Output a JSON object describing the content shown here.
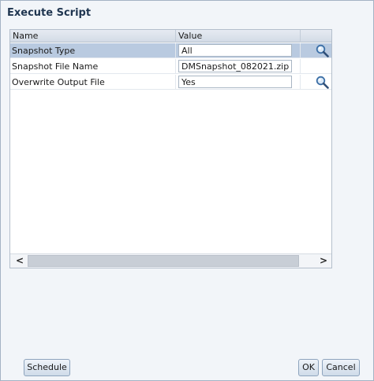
{
  "dialog": {
    "title": "Execute Script"
  },
  "grid": {
    "columns": {
      "name": "Name",
      "value": "Value"
    },
    "rows": [
      {
        "name": "Snapshot Type",
        "value": "All",
        "has_search": true,
        "selected": true
      },
      {
        "name": "Snapshot File Name",
        "value": "DMSnapshot_082021.zip",
        "has_search": false,
        "selected": false
      },
      {
        "name": "Overwrite Output File",
        "value": "Yes",
        "has_search": true,
        "selected": false
      }
    ],
    "scroll": {
      "left_arrow": "<",
      "right_arrow": ">"
    }
  },
  "buttons": {
    "schedule": "Schedule",
    "ok": "OK",
    "cancel": "Cancel"
  },
  "colors": {
    "selected_row": "#b9cae0",
    "title_text": "#1f3550"
  },
  "icons": {
    "search": "search-icon"
  }
}
